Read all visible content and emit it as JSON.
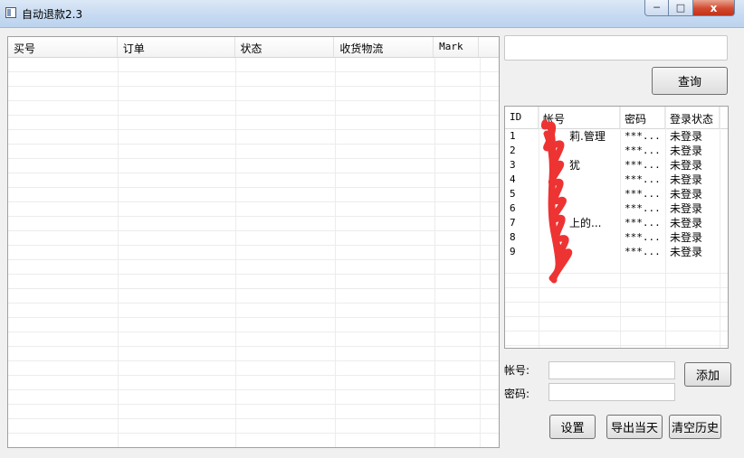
{
  "window": {
    "title": "自动退款2.3",
    "close_glyph": "x",
    "min_glyph": "─",
    "max_glyph": "□"
  },
  "main_grid": {
    "columns": [
      "买号",
      "订单",
      "状态",
      "收货物流",
      "Mark"
    ]
  },
  "search": {
    "value": "",
    "query_button": "查询"
  },
  "accounts": {
    "columns": [
      "ID",
      "帐号",
      "密码",
      "登录状态"
    ],
    "rows": [
      {
        "id": "1",
        "account": "莉.管理",
        "password": "***...",
        "status": "未登录"
      },
      {
        "id": "2",
        "account": "",
        "password": "***...",
        "status": "未登录"
      },
      {
        "id": "3",
        "account": "犹",
        "password": "***...",
        "status": "未登录"
      },
      {
        "id": "4",
        "account": "",
        "password": "***...",
        "status": "未登录"
      },
      {
        "id": "5",
        "account": "",
        "password": "***...",
        "status": "未登录"
      },
      {
        "id": "6",
        "account": "",
        "password": "***...",
        "status": "未登录"
      },
      {
        "id": "7",
        "account": "上的...",
        "password": "***...",
        "status": "未登录"
      },
      {
        "id": "8",
        "account": "",
        "password": "***...",
        "status": "未登录"
      },
      {
        "id": "9",
        "account": "",
        "password": "***...",
        "status": "未登录"
      }
    ]
  },
  "form": {
    "account_label": "帐号:",
    "password_label": "密码:",
    "account_value": "",
    "password_value": "",
    "add_button": "添加"
  },
  "footer": {
    "settings_button": "设置",
    "export_today_button": "导出当天",
    "clear_history_button": "清空历史"
  },
  "colors": {
    "redaction": "#ee3333",
    "titlebar": "#c5d9f1",
    "close": "#d2492f"
  }
}
